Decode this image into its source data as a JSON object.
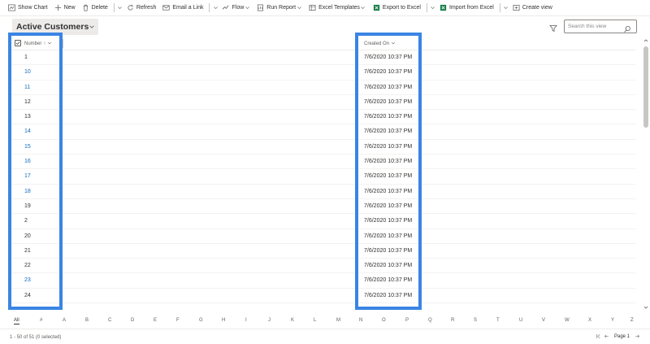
{
  "commandbar": {
    "items": [
      {
        "label": "Show Chart",
        "icon": "chart-icon"
      },
      {
        "label": "New",
        "icon": "plus-icon"
      },
      {
        "label": "Delete",
        "icon": "trash-icon"
      },
      {
        "label": "Refresh",
        "icon": "refresh-icon"
      },
      {
        "label": "Email a Link",
        "icon": "email-icon"
      },
      {
        "label": "Flow",
        "icon": "flow-icon"
      },
      {
        "label": "Run Report",
        "icon": "report-icon"
      },
      {
        "label": "Excel Templates",
        "icon": "excel-template-icon"
      },
      {
        "label": "Export to Excel",
        "icon": "export-excel-icon"
      },
      {
        "label": "Import from Excel",
        "icon": "import-excel-icon"
      },
      {
        "label": "Create view",
        "icon": "create-view-icon"
      }
    ]
  },
  "view": {
    "title": "Active Customers",
    "search_placeholder": "Search this view"
  },
  "grid": {
    "columns": [
      {
        "label": "Number",
        "sort": "↑"
      },
      {
        "label": "Created On"
      }
    ],
    "rows": [
      {
        "number": "1",
        "created_on": "7/6/2020 10:37 PM"
      },
      {
        "number": "10",
        "created_on": "7/6/2020 10:37 PM"
      },
      {
        "number": "11",
        "created_on": "7/6/2020 10:37 PM"
      },
      {
        "number": "12",
        "created_on": "7/6/2020 10:37 PM"
      },
      {
        "number": "13",
        "created_on": "7/6/2020 10:37 PM"
      },
      {
        "number": "14",
        "created_on": "7/6/2020 10:37 PM"
      },
      {
        "number": "15",
        "created_on": "7/6/2020 10:37 PM"
      },
      {
        "number": "16",
        "created_on": "7/6/2020 10:37 PM"
      },
      {
        "number": "17",
        "created_on": "7/6/2020 10:37 PM"
      },
      {
        "number": "18",
        "created_on": "7/6/2020 10:37 PM"
      },
      {
        "number": "19",
        "created_on": "7/6/2020 10:37 PM"
      },
      {
        "number": "2",
        "created_on": "7/6/2020 10:37 PM"
      },
      {
        "number": "20",
        "created_on": "7/6/2020 10:37 PM"
      },
      {
        "number": "21",
        "created_on": "7/6/2020 10:37 PM"
      },
      {
        "number": "22",
        "created_on": "7/6/2020 10:37 PM"
      },
      {
        "number": "23",
        "created_on": "7/6/2020 10:37 PM"
      },
      {
        "number": "24",
        "created_on": "7/6/2020 10:37 PM"
      }
    ]
  },
  "alphabet": [
    "All",
    "#",
    "A",
    "B",
    "C",
    "D",
    "E",
    "F",
    "G",
    "H",
    "I",
    "J",
    "K",
    "L",
    "M",
    "N",
    "O",
    "P",
    "Q",
    "R",
    "S",
    "T",
    "U",
    "V",
    "W",
    "X",
    "Y",
    "Z"
  ],
  "status": {
    "count_text": "1 - 50 of 51 (0 selected)",
    "page_label": "Page 1"
  },
  "colors": {
    "highlight": "#3a85e4",
    "link": "#0f6cbd"
  }
}
